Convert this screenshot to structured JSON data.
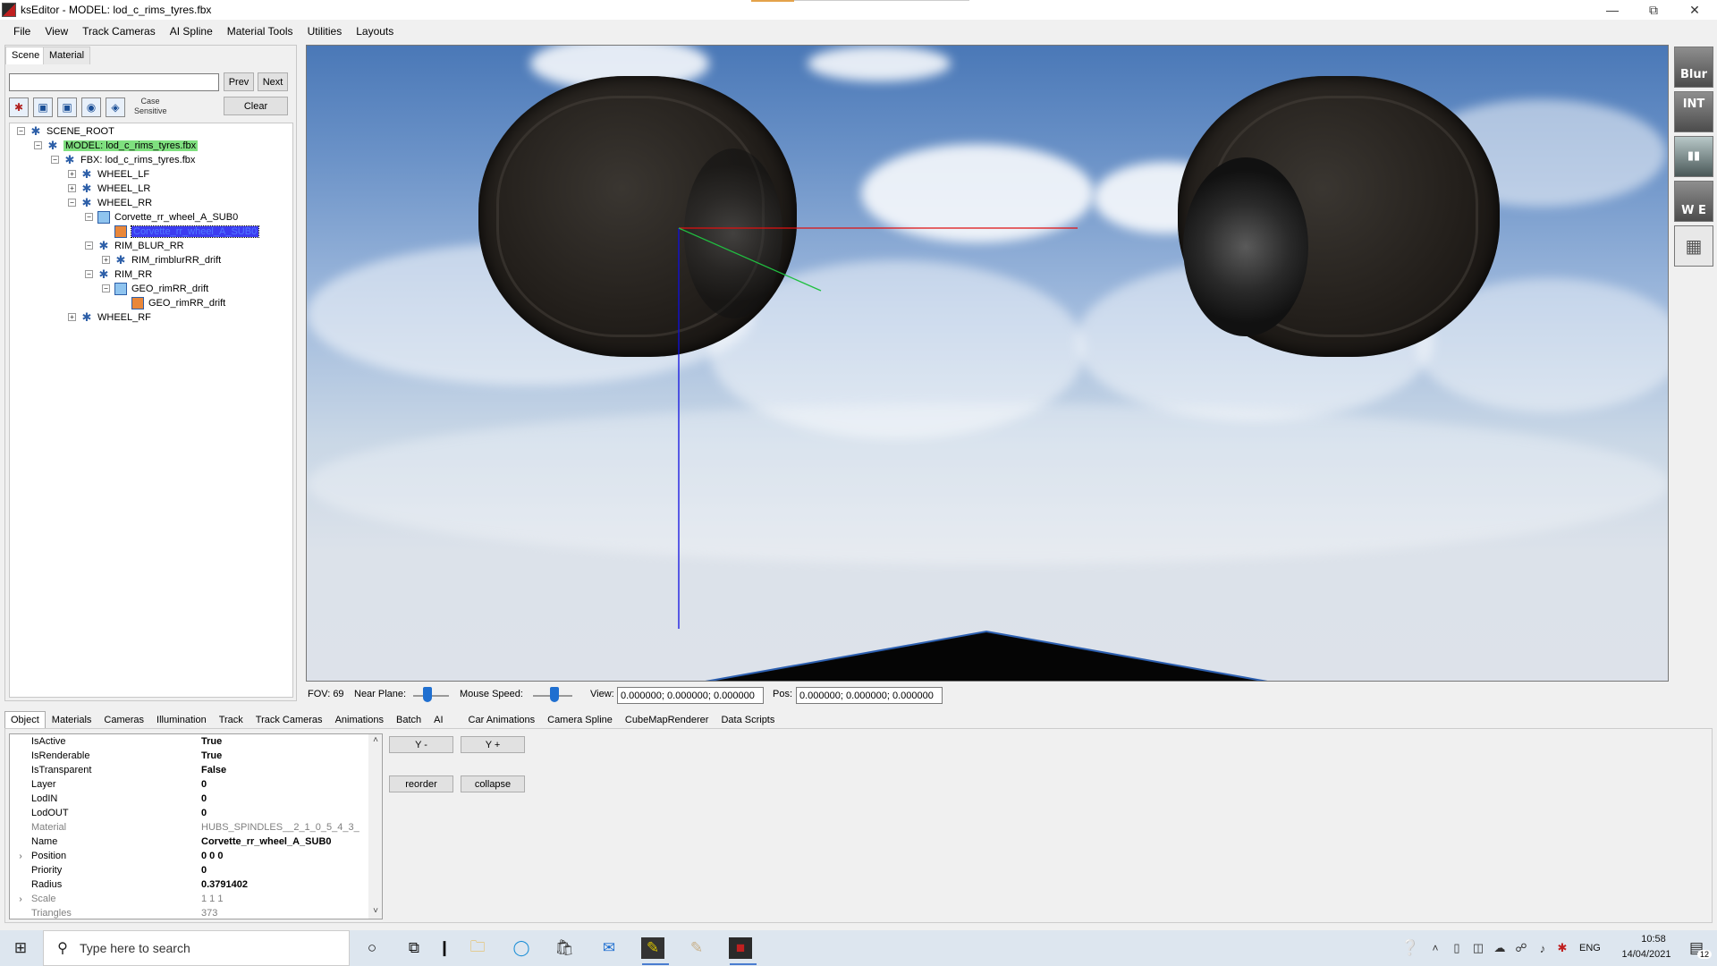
{
  "window": {
    "title": "ksEditor - MODEL: lod_c_rims_tyres.fbx",
    "minimize_icon": "minimize-icon",
    "restore_icon": "restore-icon",
    "close_icon": "close-icon"
  },
  "menu": [
    "File",
    "View",
    "Track Cameras",
    "AI Spline",
    "Material Tools",
    "Utilities",
    "Layouts"
  ],
  "left_panel": {
    "tabs": [
      "Scene",
      "Material"
    ],
    "search_value": "",
    "prev": "Prev",
    "next": "Next",
    "case_sensitive": "Case Sensitive",
    "clear": "Clear",
    "tree": [
      {
        "label": "SCENE_ROOT"
      },
      {
        "label": "MODEL: lod_c_rims_tyres.fbx"
      },
      {
        "label": "FBX: lod_c_rims_tyres.fbx"
      },
      {
        "label": "WHEEL_LF"
      },
      {
        "label": "WHEEL_LR"
      },
      {
        "label": "WHEEL_RR"
      },
      {
        "label": "Corvette_rr_wheel_A_SUB0"
      },
      {
        "label": "Corvette_rr_wheel_A_SUB0"
      },
      {
        "label": "RIM_BLUR_RR"
      },
      {
        "label": "RIM_rimblurRR_drift"
      },
      {
        "label": "RIM_RR"
      },
      {
        "label": "GEO_rimRR_drift"
      },
      {
        "label": "GEO_rimRR_drift"
      },
      {
        "label": "WHEEL_RF"
      }
    ]
  },
  "status": {
    "fov": "FOV: 69",
    "near_plane": "Near Plane:",
    "near_plane_value": 0.4,
    "mouse_speed": "Mouse Speed:",
    "mouse_speed_value": 0.55,
    "view_label": "View:",
    "view_value": "0.000000; 0.000000; 0.000000",
    "pos_label": "Pos:",
    "pos_value": "0.000000; 0.000000; 0.000000"
  },
  "bottom_tabs": [
    "Object",
    "Materials",
    "Cameras",
    "Illumination",
    "Track",
    "Track Cameras",
    "Animations",
    "Batch",
    "AI",
    "Car Animations",
    "Camera Spline",
    "CubeMapRenderer",
    "Data Scripts"
  ],
  "properties": [
    {
      "name": "IsActive",
      "value": "True"
    },
    {
      "name": "IsRenderable",
      "value": "True"
    },
    {
      "name": "IsTransparent",
      "value": "False"
    },
    {
      "name": "Layer",
      "value": "0"
    },
    {
      "name": "LodIN",
      "value": "0"
    },
    {
      "name": "LodOUT",
      "value": "0"
    },
    {
      "name": "Material",
      "value": "HUBS_SPINDLES__2_1_0_5_4_3_"
    },
    {
      "name": "Name",
      "value": "Corvette_rr_wheel_A_SUB0"
    },
    {
      "name": "Position",
      "value": "0 0 0"
    },
    {
      "name": "Priority",
      "value": "0"
    },
    {
      "name": "Radius",
      "value": "0.3791402"
    },
    {
      "name": "Scale",
      "value": "1 1 1"
    },
    {
      "name": "Triangles",
      "value": "373"
    }
  ],
  "actions": {
    "y_minus": "Y -",
    "y_plus": "Y +",
    "reorder": "reorder",
    "collapse": "collapse"
  },
  "right_toolbar": {
    "blur": "Blur",
    "int": "INT",
    "we": "W E"
  },
  "taskbar": {
    "search_placeholder": "Type here to search",
    "language": "ENG",
    "time": "10:58",
    "date": "14/04/2021",
    "notifications": "12"
  }
}
